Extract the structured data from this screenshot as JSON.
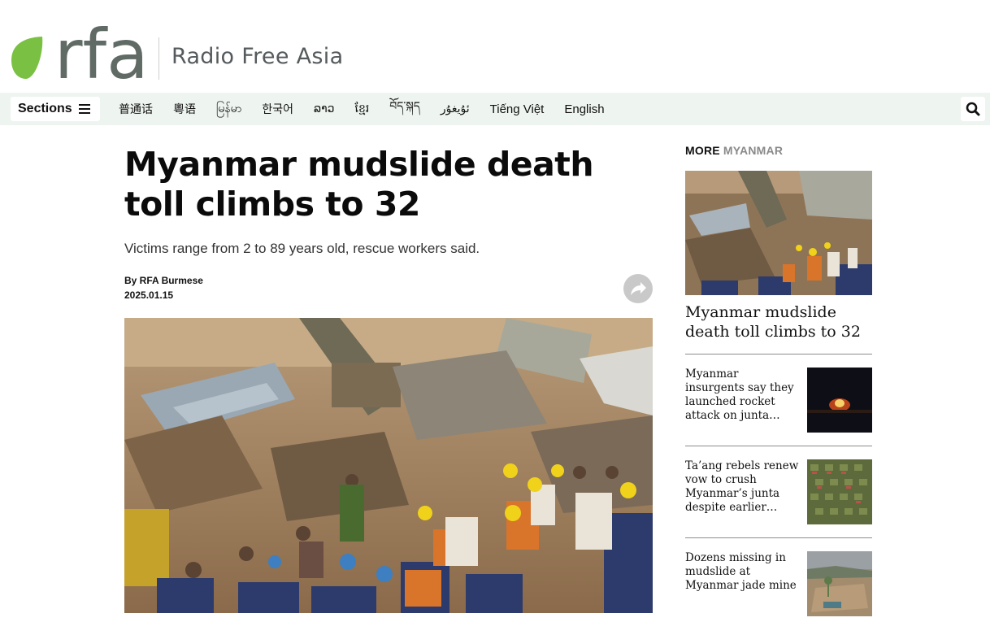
{
  "brand": {
    "logo_text": "rfa",
    "name": "Radio Free Asia",
    "logo_dot_color": "#7ac143",
    "logo_text_color": "#616b66"
  },
  "nav": {
    "sections_label": "Sections",
    "languages": [
      "普通话",
      "粵语",
      "မြန်မာ",
      "한국어",
      "ລາວ",
      "ខ្មែរ",
      "བོད་སྐད",
      "ئۇيغۇر",
      "Tiếng Việt",
      "English"
    ],
    "search_icon": "search-icon",
    "background_color": "#eef4ef"
  },
  "article": {
    "headline": "Myanmar mudslide death toll climbs to 32",
    "subhead": "Victims range from 2 to 89 years old, rescue workers said.",
    "byline": "By RFA Burmese",
    "date": "2025.01.15",
    "share_icon": "share-arrow-icon"
  },
  "sidebar": {
    "more_label": "MORE",
    "more_topic": "MYANMAR",
    "featured_title": "Myanmar mudslide death toll climbs to 32",
    "items": [
      {
        "title": "Myanmar insurgents say they launched rocket attack on junta…"
      },
      {
        "title": "Ta’ang rebels renew vow to crush Myanmar’s junta despite earlier…"
      },
      {
        "title": "Dozens missing in mudslide at Myanmar jade mine"
      }
    ]
  }
}
